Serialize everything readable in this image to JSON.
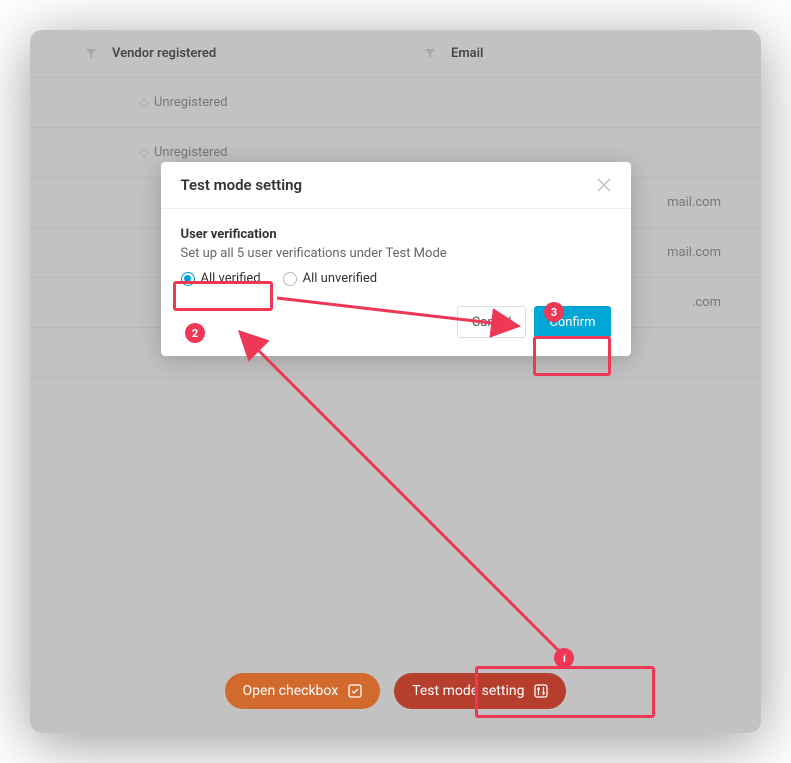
{
  "table": {
    "headers": {
      "vendor": "Vendor registered",
      "email": "Email"
    },
    "rows": [
      {
        "status": "Unregistered",
        "email": ""
      },
      {
        "status": "Unregistered",
        "email": ""
      },
      {
        "status": "",
        "email": "mail.com"
      },
      {
        "status": "",
        "email": "mail.com"
      },
      {
        "status": "",
        "email": ".com"
      }
    ]
  },
  "modal": {
    "title": "Test mode setting",
    "section_title": "User verification",
    "section_desc": "Set up all 5 user verifications under Test Mode",
    "options": {
      "verified": "All verified",
      "unverified": "All unverified"
    },
    "selected": "verified",
    "cancel": "Cancel",
    "confirm": "Confirm"
  },
  "bottom": {
    "open_checkbox": "Open checkbox",
    "test_mode": "Test mode setting"
  },
  "annotations": {
    "step1": "1",
    "step2": "2",
    "step3": "3"
  }
}
